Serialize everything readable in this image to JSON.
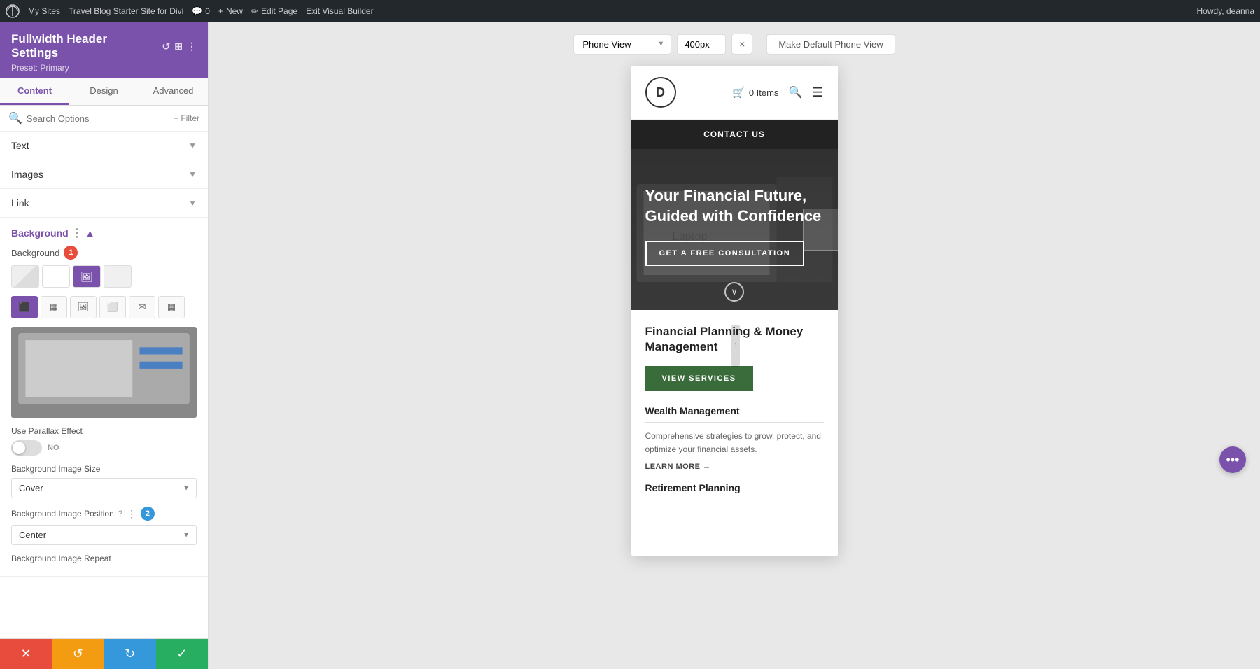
{
  "admin_bar": {
    "wp_label": "WordPress",
    "my_sites": "My Sites",
    "blog_name": "Travel Blog Starter Site for Divi",
    "comment_count": "0",
    "new_label": "New",
    "edit_page": "Edit Page",
    "exit_builder": "Exit Visual Builder",
    "howdy": "Howdy, deanna"
  },
  "sidebar": {
    "title": "Fullwidth Header Settings",
    "preset": "Preset: Primary",
    "tabs": [
      "Content",
      "Design",
      "Advanced"
    ],
    "active_tab": "Content",
    "search_placeholder": "Search Options",
    "filter_label": "+ Filter",
    "sections": {
      "text": "Text",
      "images": "Images",
      "link": "Link",
      "background": "Background"
    },
    "background": {
      "label": "Background",
      "badge_number": "1",
      "swatch_types": [
        "gradient",
        "solid",
        "image",
        "video"
      ],
      "type_icons": [
        "gradient-icon",
        "image-icon",
        "color-icon",
        "pattern-icon",
        "mask-icon",
        "video-icon"
      ],
      "parallax_label": "Use Parallax Effect",
      "parallax_value": "NO",
      "bg_size_label": "Background Image Size",
      "bg_size_value": "Cover",
      "bg_position_label": "Background Image Position",
      "bg_position_badge": "2",
      "bg_position_value": "Center",
      "bg_repeat_label": "Background Image Repeat"
    },
    "bottom_actions": {
      "cancel": "✕",
      "undo": "↺",
      "redo": "↻",
      "save": "✓"
    }
  },
  "toolbar": {
    "view_label": "Phone View",
    "px_value": "400px",
    "close": "×",
    "default_view_btn": "Make Default Phone View"
  },
  "preview": {
    "nav": {
      "logo_text": "D",
      "cart_items": "0 Items",
      "contact_btn": "CONTACT US"
    },
    "hero": {
      "title": "Your Financial Future, Guided with Confidence",
      "cta_btn": "GET A FREE CONSULTATION"
    },
    "services": {
      "title": "Financial Planning & Money Management",
      "view_btn": "VIEW SERVICES",
      "items": [
        {
          "name": "Wealth Management",
          "description": "Comprehensive strategies to grow, protect, and optimize your financial assets.",
          "learn_more": "LEARN MORE →"
        },
        {
          "name": "Retirement Planning",
          "description": "",
          "learn_more": ""
        }
      ]
    }
  }
}
